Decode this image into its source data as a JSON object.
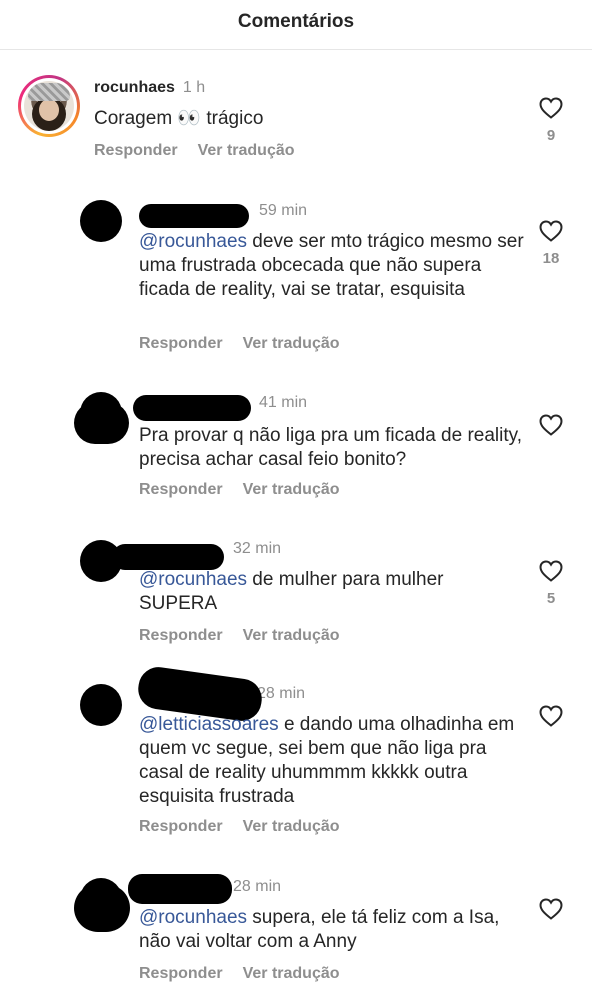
{
  "header": {
    "title": "Comentários"
  },
  "actions": {
    "reply": "Responder",
    "translate": "Ver tradução"
  },
  "icons": {
    "like": "heart-outline-icon"
  },
  "colors": {
    "mention": "#385898",
    "muted": "#8e8e8e",
    "text": "#262626"
  },
  "comments": [
    {
      "username": "rocunhaes",
      "time": "1 h",
      "mention": "",
      "text": "Coragem 👀 trágico",
      "likes": "9"
    },
    {
      "username": "",
      "time": "59 min",
      "mention": "@rocunhaes",
      "text": " deve ser mto trágico mesmo ser uma frustrada obcecada que não supera ficada de reality, vai se tratar, esquisita",
      "likes": "18"
    },
    {
      "username": "",
      "time": "41 min",
      "mention": "",
      "text": "Pra provar q não liga pra um ficada de reality, precisa achar casal feio bonito?",
      "likes": ""
    },
    {
      "username": "",
      "time": "32 min",
      "mention": "@rocunhaes",
      "text": " de mulher para mulher SUPERA",
      "likes": "5"
    },
    {
      "username": "",
      "time": "28 min",
      "mention": "@letticiassoares",
      "text": " e dando uma olhadinha em quem vc segue, sei bem que não liga pra casal de reality uhummmm kkkkk outra esquisita frustrada",
      "likes": ""
    },
    {
      "username": "",
      "time": "28 min",
      "mention": "@rocunhaes",
      "text": " supera, ele tá feliz com a Isa, não vai voltar com a Anny",
      "likes": ""
    }
  ]
}
